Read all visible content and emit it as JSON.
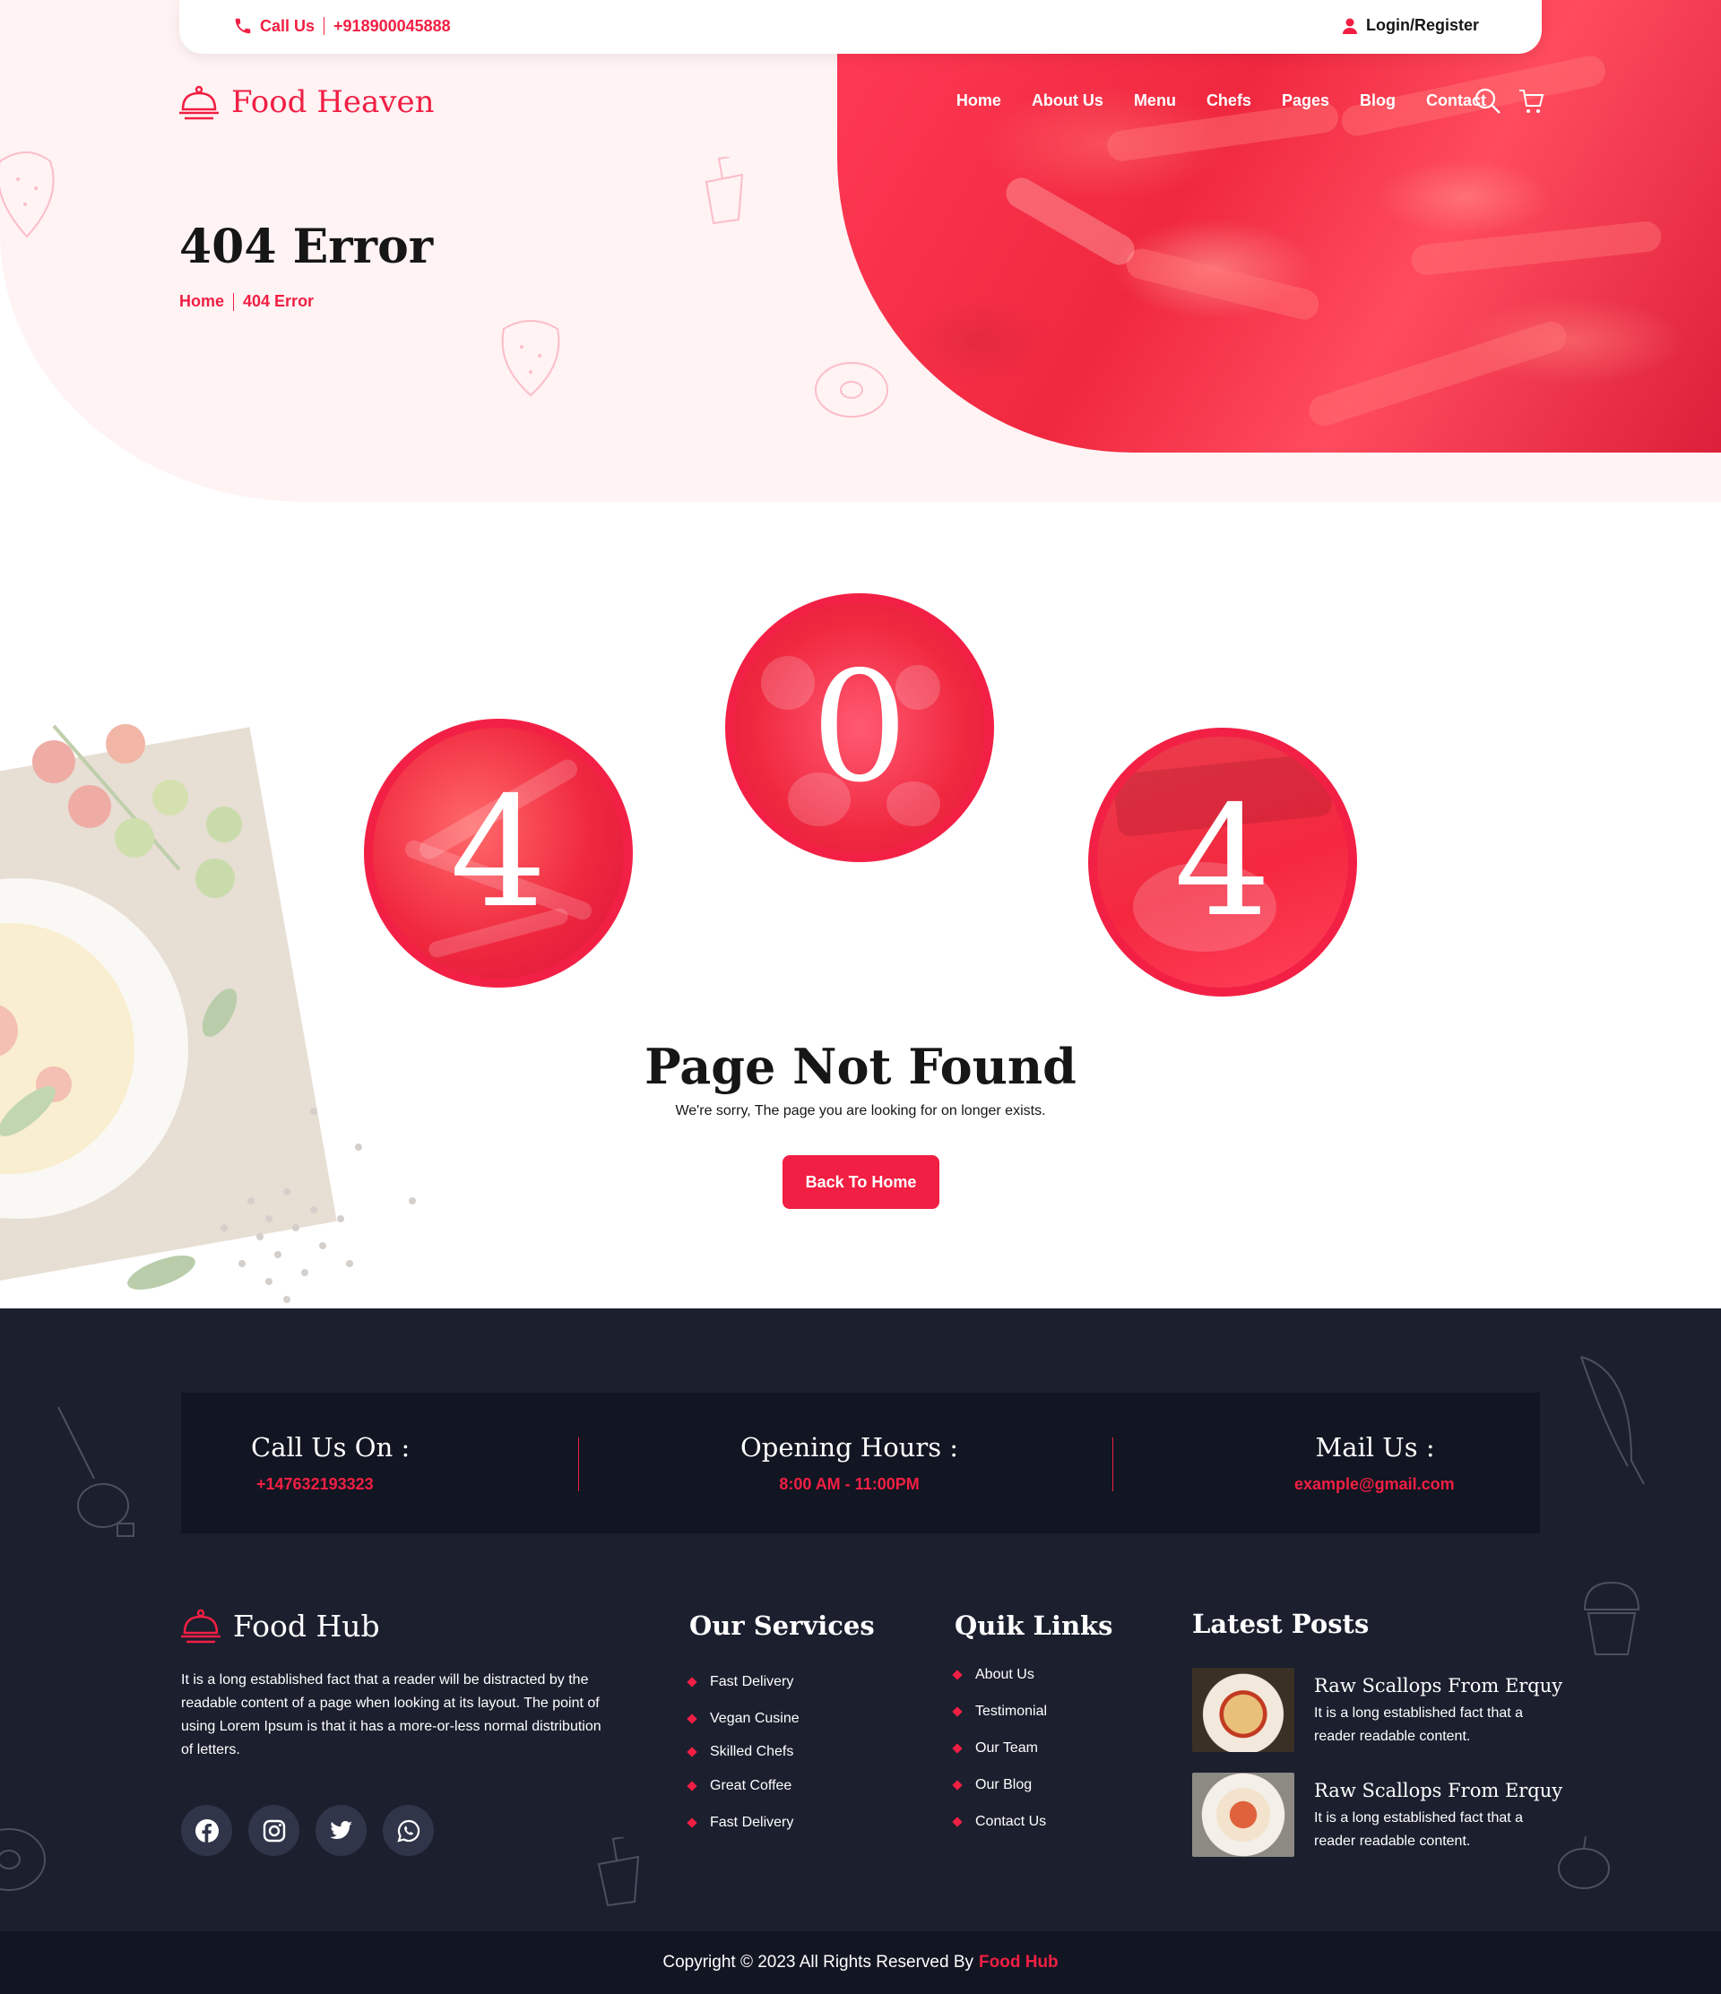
{
  "topbar": {
    "call_label": "Call Us",
    "phone": "+918900045888",
    "login": "Login/Register"
  },
  "brand": {
    "name": "Food Heaven",
    "color": "#f11f43"
  },
  "nav": {
    "items": [
      "Home",
      "About Us",
      "Menu",
      "Chefs",
      "Pages",
      "Blog",
      "Contact"
    ],
    "icons": [
      "search-icon",
      "cart-icon"
    ]
  },
  "hero": {
    "title": "404 Error",
    "breadcrumb": [
      "Home",
      "404 Error"
    ]
  },
  "error": {
    "digits": [
      "4",
      "0",
      "4"
    ],
    "title": "Page Not Found",
    "message": "We're sorry, The page you are looking for on longer exists.",
    "button": "Back To Home"
  },
  "footer": {
    "contact": [
      {
        "heading": "Call Us On :",
        "value": "+147632193323"
      },
      {
        "heading": "Opening Hours :",
        "value": "8:00 AM - 11:00PM"
      },
      {
        "heading": "Mail Us :",
        "value": "example@gmail.com"
      }
    ],
    "brand": "Food Hub",
    "about": "It is a long established fact that a reader will be distracted by the readable content of a page when looking at its layout. The point of using Lorem Ipsum is that it has a more-or-less normal distribution of letters.",
    "socials": [
      "facebook-icon",
      "instagram-icon",
      "twitter-icon",
      "whatsapp-icon"
    ],
    "services": {
      "title": "Our Services",
      "items": [
        "Fast Delivery",
        "Vegan Cusine",
        "Skilled Chefs",
        "Great Coffee",
        "Fast Delivery"
      ]
    },
    "links": {
      "title": "Quik Links",
      "items": [
        "About Us",
        "Testimonial",
        "Our Team",
        "Our Blog",
        "Contact Us"
      ]
    },
    "posts": {
      "title": "Latest Posts",
      "items": [
        {
          "title": "Raw Scallops From Erquy",
          "text": "It is a long established fact that a reader readable content."
        },
        {
          "title": "Raw Scallops From Erquy",
          "text": "It is a long established fact that a reader readable content."
        }
      ]
    }
  },
  "copyright": {
    "text": "Copyright © 2023 All Rights Reserved By",
    "brand": "Food Hub"
  },
  "colors": {
    "accent": "#f11f43",
    "footer_bg": "#1b1f2e",
    "footer_dark": "#121522",
    "hero_bg": "#fff3f4"
  }
}
